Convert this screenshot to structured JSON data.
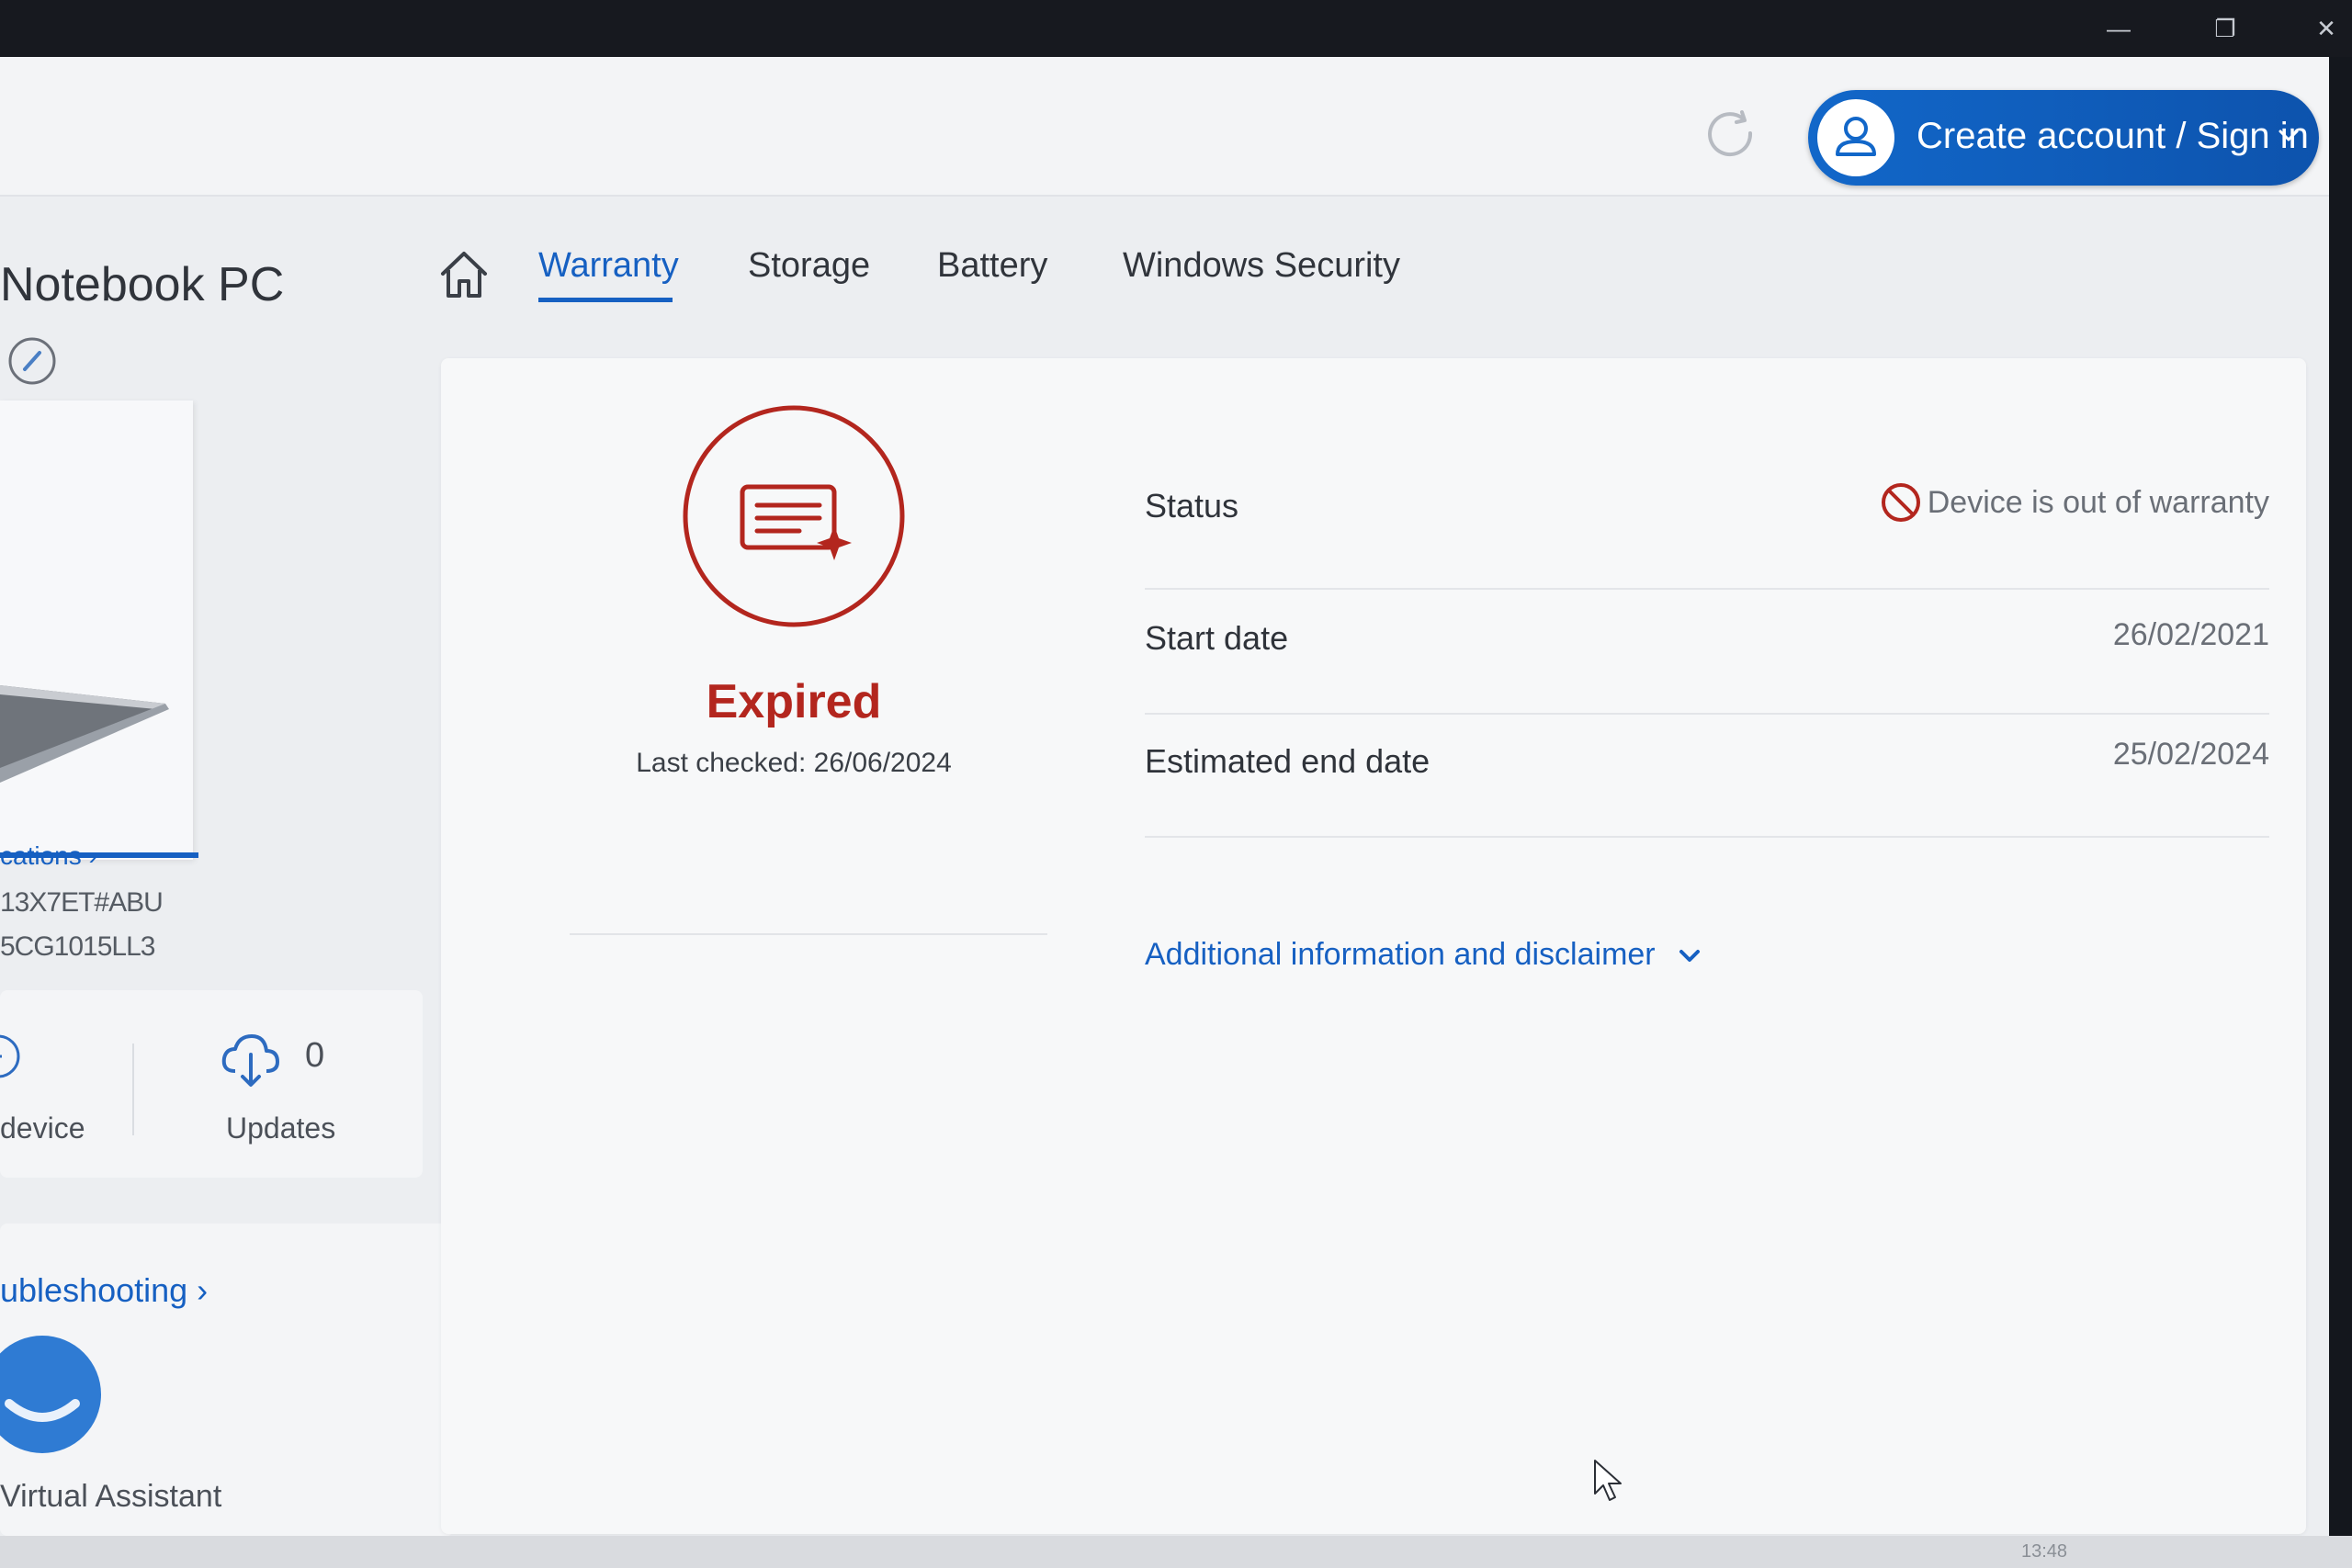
{
  "app": {
    "signin_label": "Create account / Sign in",
    "device_name": "Notebook PC",
    "specs_link": "cations ›",
    "product_lines": [
      "13X7ET#ABU",
      "5CG1015LL3"
    ],
    "stats": {
      "device_label": "device",
      "updates_count": "0",
      "updates_label": "Updates"
    },
    "troubleshooting_link": "ubleshooting ›",
    "virtual_assistant_label": "Virtual Assistant"
  },
  "tabs": [
    {
      "label": "Warranty",
      "active": true
    },
    {
      "label": "Storage",
      "active": false
    },
    {
      "label": "Battery",
      "active": false
    },
    {
      "label": "Windows Security",
      "active": false
    }
  ],
  "warranty": {
    "state": "Expired",
    "last_checked": "Last checked: 26/06/2024",
    "rows": [
      {
        "label": "Status",
        "value": "Device is out of warranty"
      },
      {
        "label": "Start date",
        "value": "26/02/2021"
      },
      {
        "label": "Estimated end date",
        "value": "25/02/2024"
      }
    ],
    "disclaimer_link": "Additional information and disclaimer"
  },
  "taskbar": {
    "clock": "13:48"
  },
  "colors": {
    "accent": "#1660c2",
    "expired": "#b3261e",
    "signin_button": "#1267c9"
  },
  "icons": [
    "home-icon",
    "refresh-icon",
    "user-icon",
    "chevron-down-icon",
    "edit-icon",
    "cloud-download-icon",
    "virtual-assistant-icon",
    "warranty-document-icon",
    "no-entry-icon",
    "mouse-cursor-icon"
  ]
}
